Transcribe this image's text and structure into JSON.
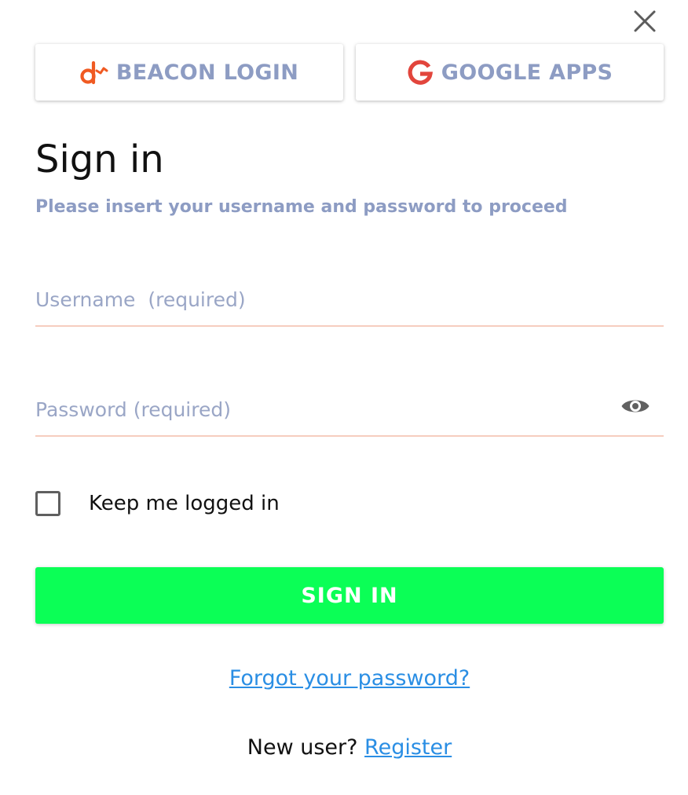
{
  "providers": {
    "beacon": {
      "label": "BEACON LOGIN",
      "icon": "beacon-logo-icon",
      "icon_color": "#f05a22"
    },
    "google": {
      "label": "GOOGLE APPS",
      "icon": "google-g-icon",
      "icon_color": "#e2453c"
    }
  },
  "form": {
    "title": "Sign in",
    "subtitle": "Please insert your username and password to proceed",
    "username_placeholder": "Username  (required)",
    "password_placeholder": "Password (required)",
    "keep_logged_in_label": "Keep me logged in",
    "submit_label": "SIGN IN",
    "forgot_password_label": "Forgot your password?",
    "new_user_text": "New user? ",
    "register_label": "Register"
  },
  "colors": {
    "accent_green": "#0bff56",
    "link_blue": "#2a8ee4",
    "muted_text": "#8d9cc3",
    "field_underline": "#f6cdbf"
  }
}
